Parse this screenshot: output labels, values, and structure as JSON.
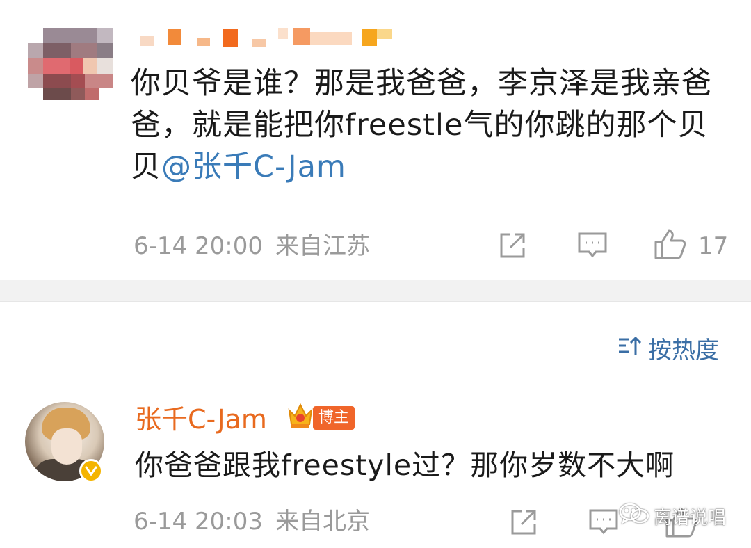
{
  "post": {
    "text_line1": "你贝爷是谁？那是我爸爸，李京泽是我亲爸",
    "text_line2": "爸，就是能把你freestle气的你跳的那个贝",
    "text_line3_prefix": "贝",
    "mention": "@张千C-Jam",
    "time": "6-14 20:00",
    "location": "来自江苏",
    "likes": "17"
  },
  "sort": {
    "label": "按热度"
  },
  "reply": {
    "username": "张千C-Jam",
    "badge": "博主",
    "text": "你爸爸跟我freestyle过？那你岁数不大啊",
    "time": "6-14 20:03",
    "location": "来自北京"
  },
  "watermark": {
    "label": "离谱说唱"
  },
  "colors": {
    "mention_blue": "#3a7bb8",
    "username_orange": "#e86a1f",
    "meta_gray": "#9a9a9a",
    "sort_blue": "#3a6ea5"
  },
  "icons": [
    "share-icon",
    "comment-icon",
    "like-icon",
    "crown-icon",
    "verified-icon",
    "wechat-icon",
    "sort-icon"
  ]
}
